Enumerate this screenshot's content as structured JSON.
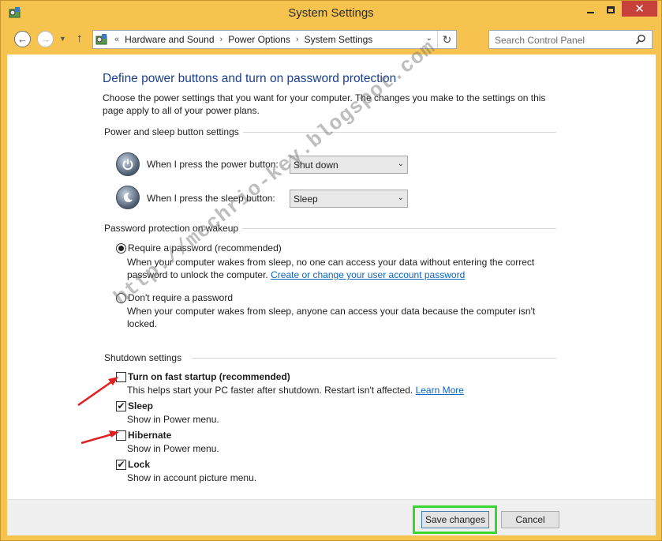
{
  "window": {
    "title": "System Settings"
  },
  "navigation": {
    "crumb_prefix": "«",
    "breadcrumbs": [
      "Hardware and Sound",
      "Power Options",
      "System Settings"
    ],
    "search_placeholder": "Search Control Panel"
  },
  "page": {
    "title": "Define power buttons and turn on password protection",
    "description": "Choose the power settings that you want for your computer. The changes you make to the settings on this page apply to all of your power plans."
  },
  "power_section": {
    "title": "Power and sleep button settings",
    "power_button_label": "When I press the power button:",
    "power_button_value": "Shut down",
    "sleep_button_label": "When I press the sleep button:",
    "sleep_button_value": "Sleep"
  },
  "password_section": {
    "title": "Password protection on wakeup",
    "require": {
      "label": "Require a password (recommended)",
      "selected": true,
      "description": "When your computer wakes from sleep, no one can access your data without entering the correct password to unlock the computer.",
      "link": "Create or change your user account password"
    },
    "dont_require": {
      "label": "Don't require a password",
      "selected": false,
      "description": "When your computer wakes from sleep, anyone can access your data because the computer isn't locked."
    }
  },
  "shutdown_section": {
    "title": "Shutdown settings",
    "items": [
      {
        "label": "Turn on fast startup (recommended)",
        "checked": false,
        "description": "This helps start your PC faster after shutdown. Restart isn't affected.",
        "link": "Learn More"
      },
      {
        "label": "Sleep",
        "checked": true,
        "description": "Show in Power menu."
      },
      {
        "label": "Hibernate",
        "checked": false,
        "description": "Show in Power menu."
      },
      {
        "label": "Lock",
        "checked": true,
        "description": "Show in account picture menu."
      }
    ]
  },
  "footer": {
    "save_label": "Save changes",
    "cancel_label": "Cancel"
  },
  "watermark": "http://mechrio-key.blogspot.com",
  "colors": {
    "window_frame": "#f6c44e",
    "title_blue": "#1a3f8d",
    "link": "#0b66c2",
    "close_button": "#c7403a",
    "highlight_green": "#39d62f",
    "annotation_red": "#e02020"
  }
}
